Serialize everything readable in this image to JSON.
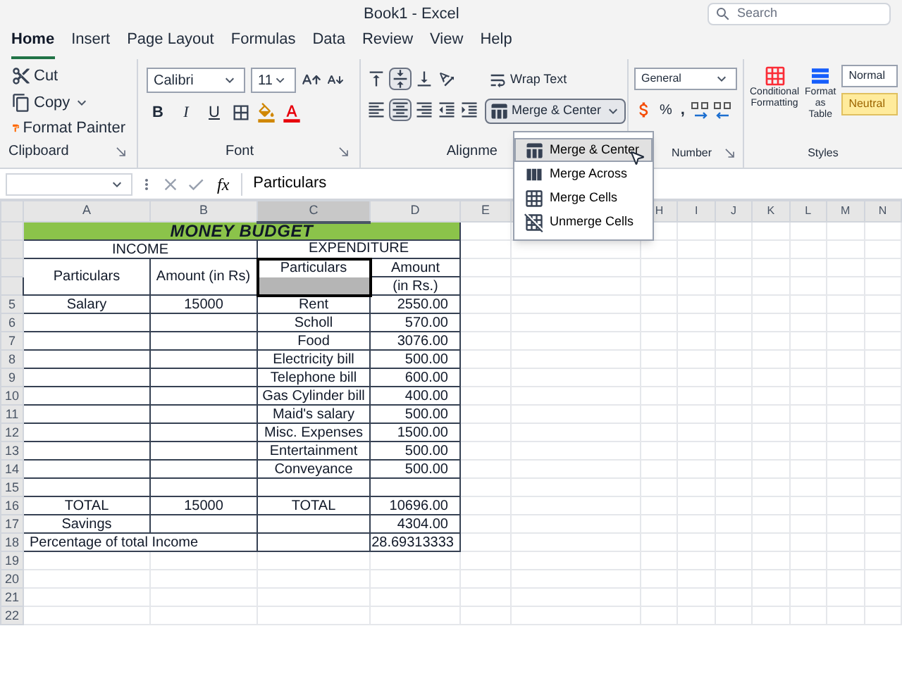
{
  "window": {
    "title": "Book1 - Excel",
    "search_placeholder": "Search"
  },
  "tabs": [
    {
      "label": "Home",
      "selected": true
    },
    {
      "label": "Insert",
      "selected": false
    },
    {
      "label": "Page Layout",
      "selected": false
    },
    {
      "label": "Formulas",
      "selected": false
    },
    {
      "label": "Data",
      "selected": false
    },
    {
      "label": "Review",
      "selected": false
    },
    {
      "label": "View",
      "selected": false
    },
    {
      "label": "Help",
      "selected": false
    }
  ],
  "ribbon": {
    "clipboard": {
      "cut": "Cut",
      "copy": "Copy",
      "format_painter": "Format Painter",
      "label": "Clipboard"
    },
    "font": {
      "name": "Calibri",
      "size": "11",
      "bold": "B",
      "italic": "I",
      "underline": "U",
      "label": "Font"
    },
    "alignment": {
      "wrap_text": "Wrap Text",
      "merge_center": "Merge & Center",
      "label": "Alignme"
    },
    "number": {
      "format": "General",
      "percent": "%",
      "comma": ",",
      "label": "Number"
    },
    "styles": {
      "conditional_formatting": "Conditional Formatting",
      "format_as_table": "Format as Table",
      "label": "Styles",
      "cell_styles": [
        {
          "label": "Normal",
          "kind": "normal"
        },
        {
          "label": "Neutral",
          "kind": "neutral"
        }
      ]
    }
  },
  "merge_menu": {
    "open": true,
    "items": [
      {
        "label": "Merge & Center",
        "selected": true
      },
      {
        "label": "Merge Across",
        "selected": false
      },
      {
        "label": "Merge Cells",
        "selected": false
      },
      {
        "label": "Unmerge Cells",
        "selected": false
      }
    ]
  },
  "formula_bar": {
    "function_label": "fx",
    "value": "Particulars"
  },
  "sheet": {
    "columns": [
      "A",
      "B",
      "C",
      "D",
      "E",
      "H",
      "I",
      "J",
      "K",
      "L",
      "M",
      "N"
    ],
    "row_numbers": [
      "5",
      "6",
      "7",
      "8",
      "9",
      "10",
      "11",
      "12",
      "13",
      "14",
      "15",
      "16",
      "17",
      "18",
      "19",
      "20",
      "21",
      "22"
    ],
    "title": "MONEY BUDGET",
    "income": {
      "heading": "INCOME",
      "columns": [
        "Particulars",
        "Amount (in Rs)"
      ],
      "items": [
        {
          "particulars": "Salary",
          "amount": "15000"
        }
      ],
      "total_label": "TOTAL",
      "total": "15000",
      "savings_label": "Savings",
      "percentage_label": "Percentage of total Income"
    },
    "expenditure": {
      "heading": "EXPENDITURE",
      "columns": [
        {
          "text": "Particulars",
          "selected": true
        },
        {
          "text": "Amount",
          "selected": false
        }
      ],
      "amount_unit": "(in Rs.)",
      "items": [
        {
          "name": "Rent",
          "amount": "2550.00"
        },
        {
          "name": "Scholl",
          "amount": "570.00"
        },
        {
          "name": "Food",
          "amount": "3076.00"
        },
        {
          "name": "Electricity bill",
          "amount": "500.00"
        },
        {
          "name": "Telephone bill",
          "amount": "600.00"
        },
        {
          "name": "Gas Cylinder bill",
          "amount": "400.00"
        },
        {
          "name": "Maid's salary",
          "amount": "500.00"
        },
        {
          "name": "Misc. Expenses",
          "amount": "1500.00"
        },
        {
          "name": "Entertainment",
          "amount": "500.00"
        },
        {
          "name": "Conveyance",
          "amount": "500.00"
        }
      ],
      "total_label": "TOTAL",
      "total": "10696.00",
      "savings": "4304.00",
      "percentage": "28.69313333"
    }
  }
}
